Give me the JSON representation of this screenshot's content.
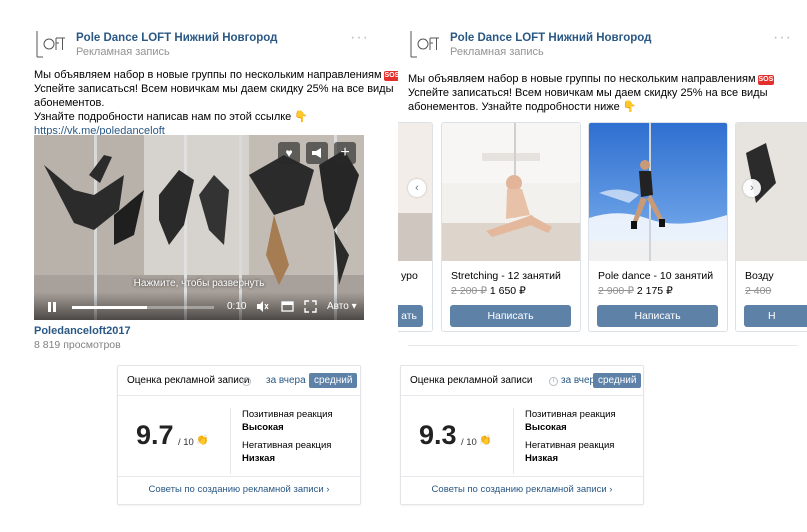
{
  "left_post": {
    "author": "Pole Dance LOFT Нижний Новгород",
    "ad_label": "Рекламная запись",
    "more_icon": "more-dots-icon",
    "text_lines": [
      "Мы объявляем набор в новые группы по нескольким направлениям",
      "Успейте записаться! Всем новичкам мы даем скидку 25% на все виды",
      "абонементов.",
      "Узнайте подробности написав нам по этой ссылке"
    ],
    "sos_badge": "SOS",
    "link": "https://vk.me/poledanceloft",
    "video": {
      "hint": "Нажмите, чтобы развернуть",
      "time": "0:10",
      "quality": "Авто",
      "progress": 0.53,
      "buttons": [
        "heart-icon",
        "megaphone-icon",
        "plus-icon"
      ]
    },
    "video_title": "Poledanceloft2017",
    "views": "8 819 просмотров"
  },
  "right_post": {
    "author": "Pole Dance LOFT Нижний Новгород",
    "ad_label": "Рекламная запись",
    "text_lines": [
      "Мы объявляем набор в новые группы по нескольким направлениям",
      "Успейте записаться! Всем новичкам мы даем скидку 25% на все виды",
      "абонементов. Узнайте подробности ниже"
    ],
    "sos_badge": "SOS",
    "cards": [
      {
        "title": "уро",
        "old_price": "",
        "price": "",
        "button": "ать"
      },
      {
        "title": "Stretching - 12 занятий",
        "old_price": "2 200 ₽",
        "price": "1 650 ₽",
        "button": "Написать"
      },
      {
        "title": "Pole dance - 10 занятий",
        "old_price": "2 900 ₽",
        "price": "2 175 ₽",
        "button": "Написать"
      },
      {
        "title": "Возду",
        "old_price": "2 400",
        "price": "",
        "button": "Н"
      }
    ]
  },
  "left_rating": {
    "title": "Оценка рекламной записи",
    "info": "i",
    "yesterday": "за вчера",
    "average": "средний",
    "score": "9.7",
    "of": "/ 10",
    "positive_label": "Позитивная реакция",
    "positive_value": "Высокая",
    "negative_label": "Негативная реакция",
    "negative_value": "Низкая",
    "footer": "Советы по созданию рекламной записи ›"
  },
  "right_rating": {
    "title": "Оценка рекламной записи",
    "info": "i",
    "yesterday": "за вчера",
    "average": "средний",
    "score": "9.3",
    "of": "/ 10",
    "positive_label": "Позитивная реакция",
    "positive_value": "Высокая",
    "negative_label": "Негативная реакция",
    "negative_value": "Низкая",
    "footer": "Советы по созданию рекламной записи ›"
  },
  "colors": {
    "link": "#2a5885",
    "button": "#5e81a8",
    "muted": "#939393",
    "sos": "#e2302c"
  }
}
